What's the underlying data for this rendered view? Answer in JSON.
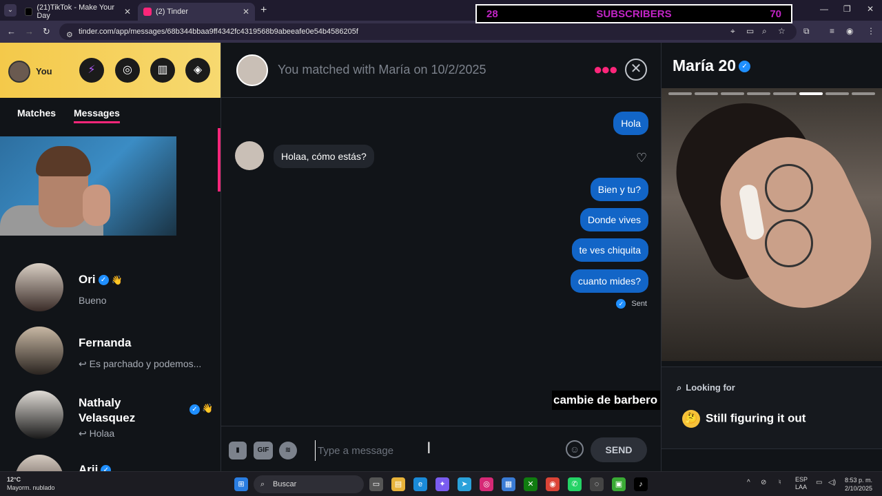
{
  "browser": {
    "tabs": [
      {
        "label": "(21)TikTok - Make Your Day",
        "color": "#111111"
      },
      {
        "label": "(2) Tinder",
        "color": "#fd267a"
      }
    ],
    "url": "tinder.com/app/messages/68b344bbaa9ff4342fc4319568b9abeeafe0e54b4586205f"
  },
  "subscribers_overlay": {
    "left": "28",
    "label": "SUBSCRIBERS",
    "right": "70"
  },
  "sidebar": {
    "user_label": "You",
    "tabs": [
      {
        "label": "Matches"
      },
      {
        "label": "Messages"
      }
    ],
    "matches": [
      {
        "name": "Ori",
        "snippet": "Bueno",
        "verified": true
      },
      {
        "name": "Fernanda",
        "snippet": "↩ Es parchado y podemos...",
        "verified": false
      },
      {
        "name_line1": "Nathaly",
        "name_line2": "Velasquez",
        "snippet": "↩ Holaa",
        "verified": true
      },
      {
        "name": "Arii",
        "snippet": "",
        "verified": true
      }
    ]
  },
  "chat": {
    "header": "You matched with María on 10/2/2025",
    "messages": [
      {
        "text": "Hola",
        "dir": "out"
      },
      {
        "text": "Holaa, cómo estás?",
        "dir": "in"
      },
      {
        "text": "Bien y tu?",
        "dir": "out"
      },
      {
        "text": "Donde vives",
        "dir": "out"
      },
      {
        "text": "te ves chiquita",
        "dir": "out"
      },
      {
        "text": "cuanto mides?",
        "dir": "out"
      }
    ],
    "status": "Sent",
    "caption": "cambie de barbero",
    "composer": {
      "placeholder": "Type a message",
      "gif_label": "GIF",
      "send_label": "SEND"
    }
  },
  "profile": {
    "name": "María 20",
    "looking_for_label": "Looking for",
    "looking_for_value": "Still figuring it out",
    "photo_count": 8,
    "photo_index": 5
  },
  "taskbar": {
    "temp": "12°C",
    "weather": "Mayorm. nublado",
    "search": "Buscar",
    "lang1": "ESP",
    "lang2": "LAA",
    "time": "8:53 p. m.",
    "date": "2/10/2025"
  },
  "colors": {
    "brand": "#fd267a",
    "bubble_out": "#1265c7",
    "verified": "#1f8fff",
    "overlay_text": "#c224c6"
  }
}
